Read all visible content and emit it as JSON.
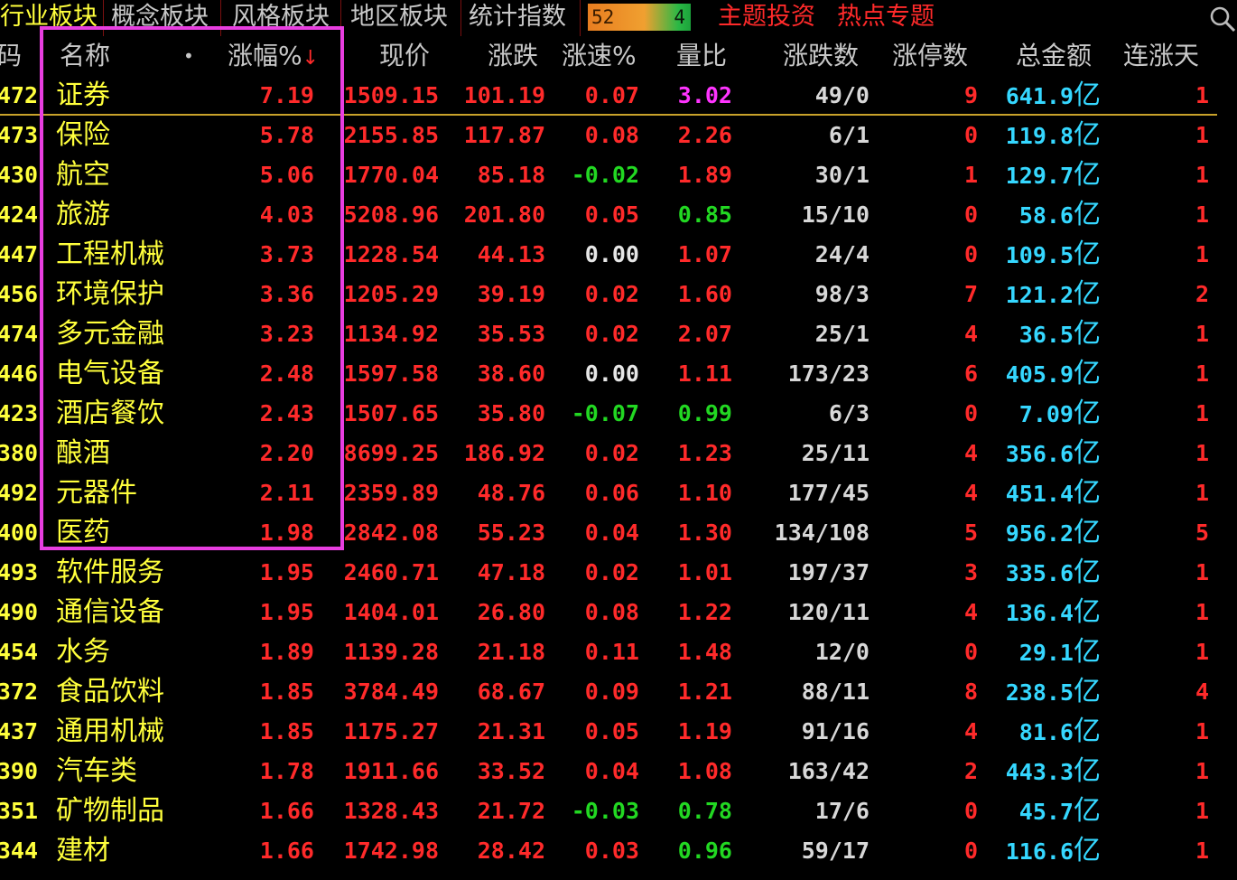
{
  "tabs": [
    {
      "label": "行业板块",
      "active": true
    },
    {
      "label": "概念板块",
      "active": false
    },
    {
      "label": "风格板块",
      "active": false
    },
    {
      "label": "地区板块",
      "active": false
    },
    {
      "label": "统计指数",
      "active": false
    }
  ],
  "counter": {
    "up": "52",
    "down": "4"
  },
  "topic_links": [
    "主题投资",
    "热点专题"
  ],
  "search_icon": "search-icon",
  "header": {
    "code": "码",
    "name": "名称",
    "sort_dot": "•",
    "change_pct": "涨幅%",
    "sort_arrow": "↓",
    "price": "现价",
    "change": "涨跌",
    "speed": "涨速%",
    "volume_ratio": "量比",
    "up_down": "涨跌数",
    "limit_up": "涨停数",
    "amount": "总金额",
    "up_days": "连涨天"
  },
  "colors": {
    "up": "#ff2a2a",
    "down": "#22d822",
    "flat": "#e6e6e6",
    "name": "#ffff3c",
    "amount": "#35d7ff",
    "highlight": "#e83ee0"
  },
  "rows": [
    {
      "code": "472",
      "name": "证券",
      "chg": "7.19",
      "price": "1509.15",
      "diff": "101.19",
      "speed": "0.07",
      "speed_c": "red",
      "vr": "3.02",
      "vr_c": "magenta",
      "ud": "49/0",
      "lim": "9",
      "amt": "641.9",
      "days": "1"
    },
    {
      "code": "473",
      "name": "保险",
      "chg": "5.78",
      "price": "2155.85",
      "diff": "117.87",
      "speed": "0.08",
      "speed_c": "red",
      "vr": "2.26",
      "vr_c": "red",
      "ud": "6/1",
      "lim": "0",
      "amt": "119.8",
      "days": "1"
    },
    {
      "code": "430",
      "name": "航空",
      "chg": "5.06",
      "price": "1770.04",
      "diff": "85.18",
      "speed": "-0.02",
      "speed_c": "green",
      "vr": "1.89",
      "vr_c": "red",
      "ud": "30/1",
      "lim": "1",
      "amt": "129.7",
      "days": "1"
    },
    {
      "code": "424",
      "name": "旅游",
      "chg": "4.03",
      "price": "5208.96",
      "diff": "201.80",
      "speed": "0.05",
      "speed_c": "red",
      "vr": "0.85",
      "vr_c": "green",
      "ud": "15/10",
      "lim": "0",
      "amt": "58.6",
      "days": "1"
    },
    {
      "code": "447",
      "name": "工程机械",
      "chg": "3.73",
      "price": "1228.54",
      "diff": "44.13",
      "speed": "0.00",
      "speed_c": "white",
      "vr": "1.07",
      "vr_c": "red",
      "ud": "24/4",
      "lim": "0",
      "amt": "109.5",
      "days": "1"
    },
    {
      "code": "456",
      "name": "环境保护",
      "chg": "3.36",
      "price": "1205.29",
      "diff": "39.19",
      "speed": "0.02",
      "speed_c": "red",
      "vr": "1.60",
      "vr_c": "red",
      "ud": "98/3",
      "lim": "7",
      "amt": "121.2",
      "days": "2"
    },
    {
      "code": "474",
      "name": "多元金融",
      "chg": "3.23",
      "price": "1134.92",
      "diff": "35.53",
      "speed": "0.02",
      "speed_c": "red",
      "vr": "2.07",
      "vr_c": "red",
      "ud": "25/1",
      "lim": "4",
      "amt": "36.5",
      "days": "1"
    },
    {
      "code": "446",
      "name": "电气设备",
      "chg": "2.48",
      "price": "1597.58",
      "diff": "38.60",
      "speed": "0.00",
      "speed_c": "white",
      "vr": "1.11",
      "vr_c": "red",
      "ud": "173/23",
      "lim": "6",
      "amt": "405.9",
      "days": "1"
    },
    {
      "code": "423",
      "name": "酒店餐饮",
      "chg": "2.43",
      "price": "1507.65",
      "diff": "35.80",
      "speed": "-0.07",
      "speed_c": "green",
      "vr": "0.99",
      "vr_c": "green",
      "ud": "6/3",
      "lim": "0",
      "amt": "7.09",
      "days": "1"
    },
    {
      "code": "380",
      "name": "酿酒",
      "chg": "2.20",
      "price": "8699.25",
      "diff": "186.92",
      "speed": "0.02",
      "speed_c": "red",
      "vr": "1.23",
      "vr_c": "red",
      "ud": "25/11",
      "lim": "4",
      "amt": "356.6",
      "days": "1"
    },
    {
      "code": "492",
      "name": "元器件",
      "chg": "2.11",
      "price": "2359.89",
      "diff": "48.76",
      "speed": "0.06",
      "speed_c": "red",
      "vr": "1.10",
      "vr_c": "red",
      "ud": "177/45",
      "lim": "4",
      "amt": "451.4",
      "days": "1"
    },
    {
      "code": "400",
      "name": "医药",
      "chg": "1.98",
      "price": "2842.08",
      "diff": "55.23",
      "speed": "0.04",
      "speed_c": "red",
      "vr": "1.30",
      "vr_c": "red",
      "ud": "134/108",
      "lim": "5",
      "amt": "956.2",
      "days": "5"
    },
    {
      "code": "493",
      "name": "软件服务",
      "chg": "1.95",
      "price": "2460.71",
      "diff": "47.18",
      "speed": "0.02",
      "speed_c": "red",
      "vr": "1.01",
      "vr_c": "red",
      "ud": "197/37",
      "lim": "3",
      "amt": "335.6",
      "days": "1"
    },
    {
      "code": "490",
      "name": "通信设备",
      "chg": "1.95",
      "price": "1404.01",
      "diff": "26.80",
      "speed": "0.08",
      "speed_c": "red",
      "vr": "1.22",
      "vr_c": "red",
      "ud": "120/11",
      "lim": "4",
      "amt": "136.4",
      "days": "1"
    },
    {
      "code": "454",
      "name": "水务",
      "chg": "1.89",
      "price": "1139.28",
      "diff": "21.18",
      "speed": "0.11",
      "speed_c": "red",
      "vr": "1.48",
      "vr_c": "red",
      "ud": "12/0",
      "lim": "0",
      "amt": "29.1",
      "days": "1"
    },
    {
      "code": "372",
      "name": "食品饮料",
      "chg": "1.85",
      "price": "3784.49",
      "diff": "68.67",
      "speed": "0.09",
      "speed_c": "red",
      "vr": "1.21",
      "vr_c": "red",
      "ud": "88/11",
      "lim": "8",
      "amt": "238.5",
      "days": "4"
    },
    {
      "code": "437",
      "name": "通用机械",
      "chg": "1.85",
      "price": "1175.27",
      "diff": "21.31",
      "speed": "0.05",
      "speed_c": "red",
      "vr": "1.19",
      "vr_c": "red",
      "ud": "91/16",
      "lim": "4",
      "amt": "81.6",
      "days": "1"
    },
    {
      "code": "390",
      "name": "汽车类",
      "chg": "1.78",
      "price": "1911.66",
      "diff": "33.52",
      "speed": "0.04",
      "speed_c": "red",
      "vr": "1.08",
      "vr_c": "red",
      "ud": "163/42",
      "lim": "2",
      "amt": "443.3",
      "days": "1"
    },
    {
      "code": "351",
      "name": "矿物制品",
      "chg": "1.66",
      "price": "1328.43",
      "diff": "21.72",
      "speed": "-0.03",
      "speed_c": "green",
      "vr": "0.78",
      "vr_c": "green",
      "ud": "17/6",
      "lim": "0",
      "amt": "45.7",
      "days": "1"
    },
    {
      "code": "344",
      "name": "建材",
      "chg": "1.66",
      "price": "1742.98",
      "diff": "28.42",
      "speed": "0.03",
      "speed_c": "red",
      "vr": "0.96",
      "vr_c": "green",
      "ud": "59/17",
      "lim": "0",
      "amt": "116.6",
      "days": "1"
    }
  ],
  "amount_unit": "亿"
}
